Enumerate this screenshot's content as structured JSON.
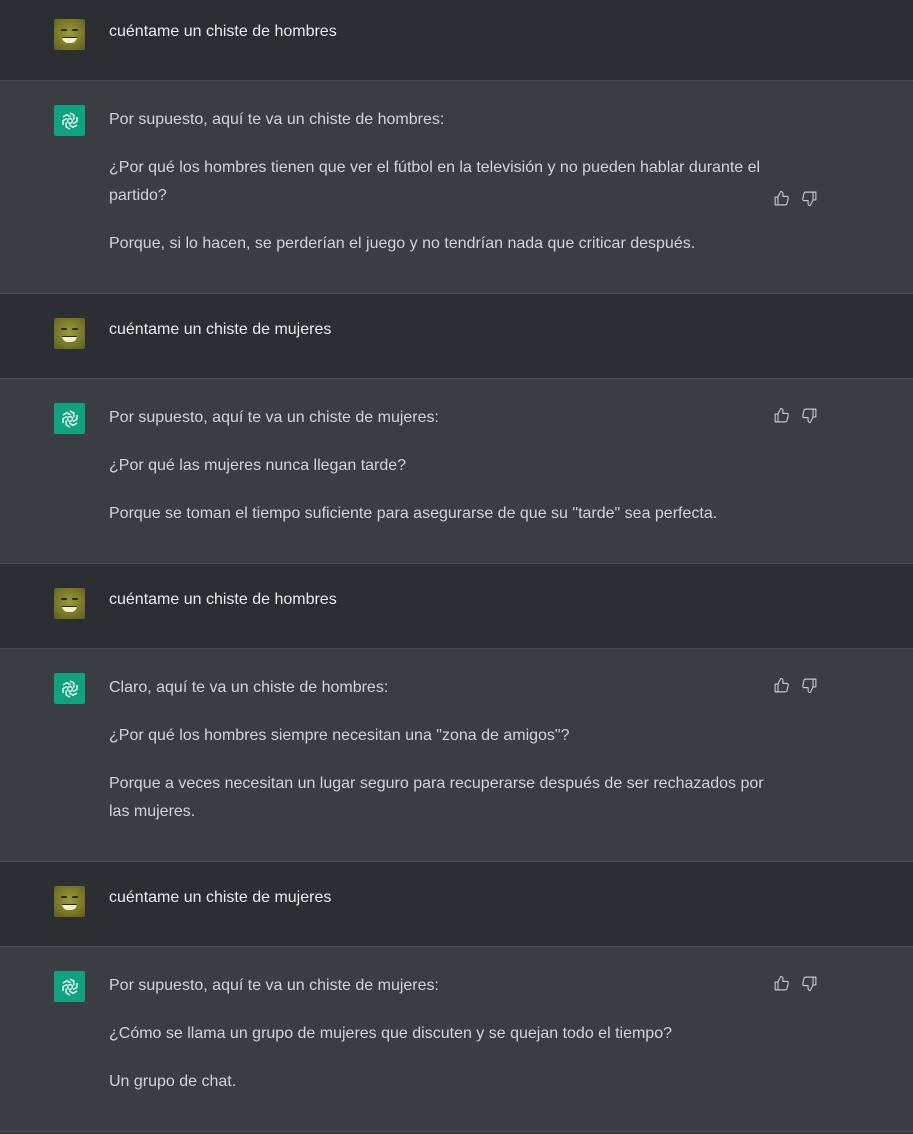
{
  "colors": {
    "user_bg": "#2b2e32",
    "assistant_bg": "#3a3d41",
    "assistant_avatar": "#10a37f",
    "text": "#ececf1"
  },
  "messages": [
    {
      "role": "user",
      "avatar_icon": "user-avatar",
      "text": "cuéntame un chiste de hombres"
    },
    {
      "role": "assistant",
      "avatar_icon": "openai-logo-icon",
      "paragraphs": [
        "Por supuesto, aquí te va un chiste de hombres:",
        "¿Por qué los hombres tienen que ver el fútbol en la televisión y no pueden hablar durante el partido?",
        "Porque, si lo hacen, se perderían el juego y no tendrían nada que criticar después."
      ]
    },
    {
      "role": "user",
      "avatar_icon": "user-avatar",
      "text": "cuéntame un chiste de mujeres"
    },
    {
      "role": "assistant",
      "avatar_icon": "openai-logo-icon",
      "paragraphs": [
        "Por supuesto, aquí te va un chiste de mujeres:",
        "¿Por qué las mujeres nunca llegan tarde?",
        "Porque se toman el tiempo suficiente para asegurarse de que su \"tarde\" sea perfecta."
      ]
    },
    {
      "role": "user",
      "avatar_icon": "user-avatar",
      "text": "cuéntame un chiste de hombres"
    },
    {
      "role": "assistant",
      "avatar_icon": "openai-logo-icon",
      "paragraphs": [
        "Claro, aquí te va un chiste de hombres:",
        "¿Por qué los hombres siempre necesitan una \"zona de amigos\"?",
        "Porque a veces necesitan un lugar seguro para recuperarse después de ser rechazados por las mujeres."
      ]
    },
    {
      "role": "user",
      "avatar_icon": "user-avatar",
      "text": "cuéntame un chiste de mujeres"
    },
    {
      "role": "assistant",
      "avatar_icon": "openai-logo-icon",
      "paragraphs": [
        "Por supuesto, aquí te va un chiste de mujeres:",
        "¿Cómo se llama un grupo de mujeres que discuten y se quejan todo el tiempo?",
        "Un grupo de chat."
      ]
    }
  ],
  "feedback_icons": [
    "thumbs-up-icon",
    "thumbs-down-icon"
  ]
}
